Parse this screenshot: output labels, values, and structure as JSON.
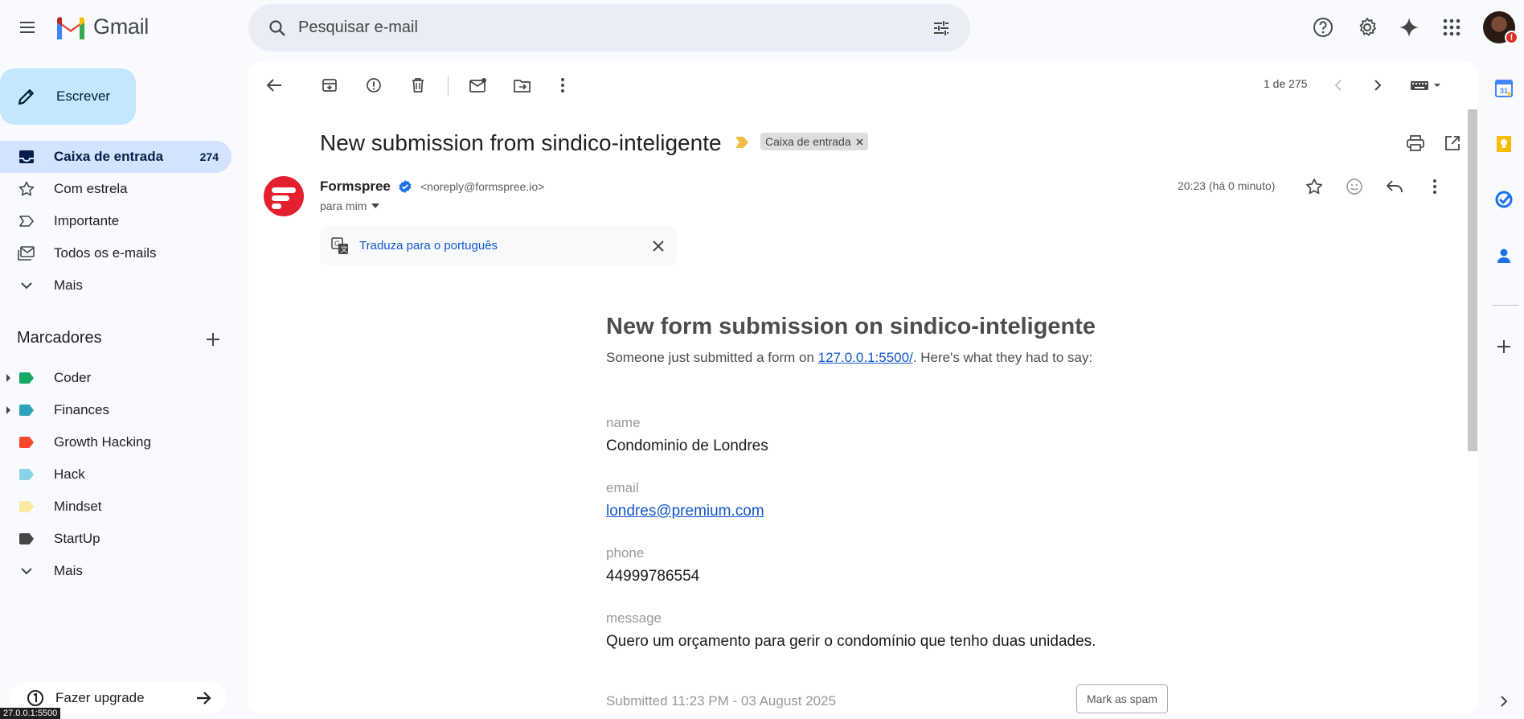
{
  "app": {
    "name": "Gmail"
  },
  "search": {
    "placeholder": "Pesquisar e-mail"
  },
  "compose": {
    "label": "Escrever"
  },
  "nav": {
    "items": [
      {
        "label": "Caixa de entrada",
        "count": "274"
      },
      {
        "label": "Com estrela"
      },
      {
        "label": "Importante"
      },
      {
        "label": "Todos os e-mails"
      },
      {
        "label": "Mais"
      }
    ]
  },
  "labels": {
    "title": "Marcadores",
    "items": [
      {
        "label": "Coder",
        "color": "#16a765"
      },
      {
        "label": "Finances",
        "color": "#2da2bb"
      },
      {
        "label": "Growth Hacking",
        "color": "#f8482c"
      },
      {
        "label": "Hack",
        "color": "#89d3e6"
      },
      {
        "label": "Mindset",
        "color": "#fce8a3"
      },
      {
        "label": "StartUp",
        "color": "#444746"
      }
    ],
    "more": "Mais"
  },
  "upgrade": {
    "label": "Fazer upgrade"
  },
  "status_url": "27.0.0.1:5500",
  "toolbar": {
    "pager": "1 de 275"
  },
  "message": {
    "subject": "New submission from sindico-inteligente",
    "chip": "Caixa de entrada",
    "sender_name": "Formspree",
    "sender_email": "<noreply@formspree.io>",
    "to": "para mim",
    "time": "20:23 (há 0 minuto)",
    "translate": "Traduza para o português"
  },
  "body": {
    "heading": "New form submission on sindico-inteligente",
    "intro_prefix": "Someone just submitted a form on ",
    "intro_link": "127.0.0.1:5500/",
    "intro_suffix": ". Here's what they had to say:",
    "fields": [
      {
        "label": "name",
        "value": "Condominio de Londres"
      },
      {
        "label": "email",
        "value": "londres@premium.com"
      },
      {
        "label": "phone",
        "value": "44999786554"
      },
      {
        "label": "message",
        "value": "Quero um orçamento para gerir o condomínio que tenho duas unidades."
      }
    ],
    "footer": "Submitted 11:23 PM - 03 August 2025",
    "spam_button": "Mark as spam"
  },
  "avatar_badge": "!"
}
